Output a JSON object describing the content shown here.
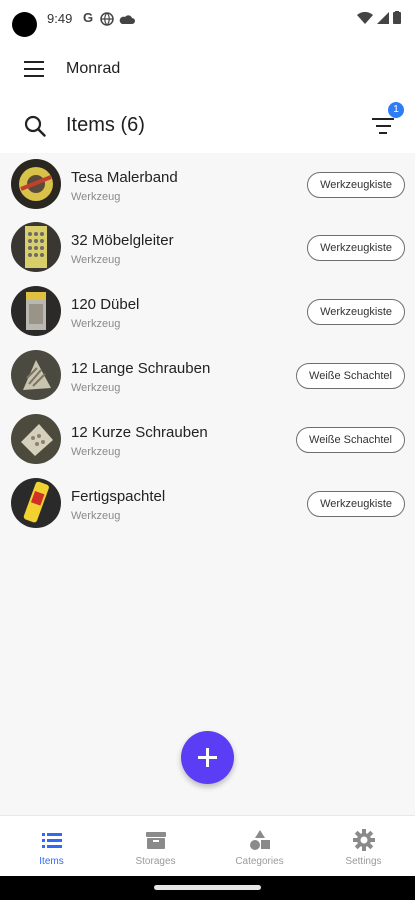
{
  "status_bar": {
    "time": "9:49",
    "icons": [
      "google-g-icon",
      "vpn-globe-icon",
      "cloud-icon",
      "wifi-icon",
      "signal-icon",
      "battery-icon"
    ]
  },
  "app_bar": {
    "title": "Monrad",
    "menu_icon": "hamburger-menu-icon"
  },
  "items_header": {
    "title": "Items (6)",
    "search_icon": "search-icon",
    "filter_icon": "filter-icon",
    "filter_badge": "1"
  },
  "items": [
    {
      "name": "Tesa Malerband",
      "category": "Werkzeug",
      "storage": "Werkzeugkiste",
      "thumb": "tape-thumbnail"
    },
    {
      "name": "32  Möbelgleiter",
      "category": "Werkzeug",
      "storage": "Werkzeugkiste",
      "thumb": "furniture-glides-thumbnail"
    },
    {
      "name": "120  Dübel",
      "category": "Werkzeug",
      "storage": "Werkzeugkiste",
      "thumb": "dowels-thumbnail"
    },
    {
      "name": "12  Lange Schrauben",
      "category": "Werkzeug",
      "storage": "Weiße Schachtel",
      "thumb": "long-screws-thumbnail"
    },
    {
      "name": "12  Kurze Schrauben",
      "category": "Werkzeug",
      "storage": "Weiße Schachtel",
      "thumb": "short-screws-thumbnail"
    },
    {
      "name": "Fertigspachtel",
      "category": "Werkzeug",
      "storage": "Werkzeugkiste",
      "thumb": "filler-tube-thumbnail"
    }
  ],
  "fab": {
    "icon": "plus-icon"
  },
  "bottom_nav": [
    {
      "label": "Items",
      "icon": "list-icon",
      "active": true
    },
    {
      "label": "Storages",
      "icon": "box-icon",
      "active": false
    },
    {
      "label": "Categories",
      "icon": "shapes-icon",
      "active": false
    },
    {
      "label": "Settings",
      "icon": "gear-icon",
      "active": false
    }
  ],
  "colors": {
    "accent": "#5b3df5",
    "nav_active": "#2f6cf6",
    "badge": "#2f7df6"
  }
}
